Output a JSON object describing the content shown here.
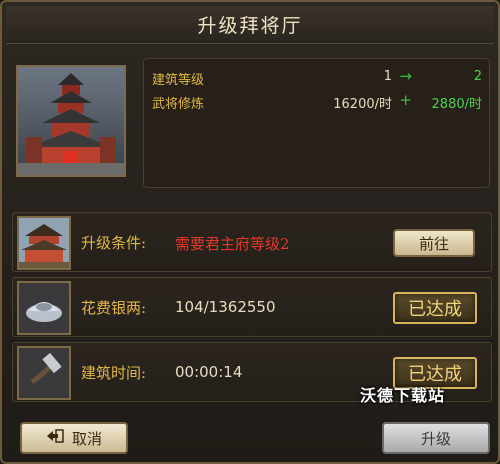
{
  "title": "升级拜将厅",
  "stats": [
    {
      "label": "建筑等级",
      "from": "1",
      "op": "→",
      "to": "2"
    },
    {
      "label": "武将修炼",
      "from": "16200/时",
      "op": "+",
      "to": "2880/时"
    }
  ],
  "requirements": [
    {
      "icon": "palace-icon",
      "label": "升级条件:",
      "value": "需要君主府等级2",
      "action": "前往"
    },
    {
      "icon": "silver-ingot-icon",
      "label": "花费银两:",
      "value": "104/1362550",
      "status": "已达成"
    },
    {
      "icon": "hammer-icon",
      "label": "建筑时间:",
      "value": "00:00:14",
      "status": "已达成"
    }
  ],
  "buttons": {
    "cancel": "取消",
    "upgrade": "升级"
  },
  "watermark": "沃德下载站",
  "colors": {
    "accent_gold": "#e0b84a",
    "increase_green": "#4fd04f",
    "warning_red": "#e23a2a"
  }
}
